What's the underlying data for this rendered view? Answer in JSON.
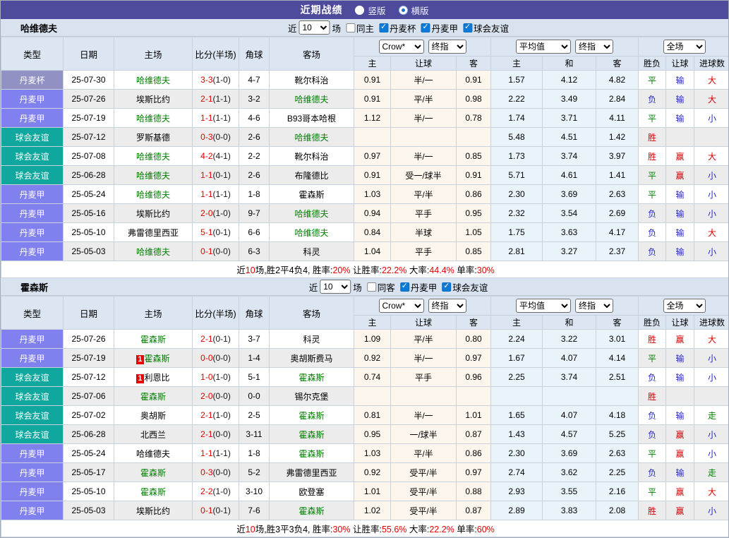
{
  "title_bar": {
    "title": "近期战绩",
    "layout_options": [
      {
        "label": "竖版",
        "selected": false
      },
      {
        "label": "横版",
        "selected": true
      }
    ]
  },
  "table_header": {
    "left_columns": [
      "类型",
      "日期",
      "主场",
      "比分(半场)",
      "角球",
      "客场"
    ],
    "handicap_group_selects": [
      "Crow*",
      "终指"
    ],
    "europe_group_selects": [
      "平均值",
      "终指"
    ],
    "result_group_select": "全场",
    "sub_columns": [
      "主",
      "让球",
      "客",
      "主",
      "和",
      "客",
      "胜负",
      "让球",
      "进球数"
    ]
  },
  "league_colors": {
    "丹麦杯": "#9191c4",
    "丹麦甲": "#8080ee",
    "球会友谊": "#0fa79e"
  },
  "red_card_label": "1",
  "sections": [
    {
      "team": "哈维德夫",
      "filter": {
        "prefix": "近",
        "count": "10",
        "suffix": "场",
        "same_label": "同主",
        "same_checked": false,
        "leagues": [
          {
            "label": "丹麦杯",
            "checked": true
          },
          {
            "label": "丹麦甲",
            "checked": true
          },
          {
            "label": "球会友谊",
            "checked": true
          }
        ]
      },
      "rows": [
        {
          "league": "丹麦杯",
          "date": "25-07-30",
          "home": {
            "name": "哈维德夫",
            "focus": true
          },
          "ft": "3-3",
          "ht": "(1-0)",
          "corners": "4-7",
          "away": {
            "name": "靴尔科治"
          },
          "handicap": [
            "0.91",
            "半/一",
            "0.91"
          ],
          "europe": [
            "1.57",
            "4.12",
            "4.82"
          ],
          "results": [
            {
              "t": "平",
              "c": "green"
            },
            {
              "t": "输",
              "c": "blue"
            },
            {
              "t": "大",
              "c": "red"
            }
          ]
        },
        {
          "league": "丹麦甲",
          "date": "25-07-26",
          "home": {
            "name": "埃斯比约"
          },
          "ft": "2-1",
          "ht": "(1-1)",
          "corners": "3-2",
          "away": {
            "name": "哈维德夫",
            "focus": true
          },
          "handicap": [
            "0.91",
            "平/半",
            "0.98"
          ],
          "europe": [
            "2.22",
            "3.49",
            "2.84"
          ],
          "results": [
            {
              "t": "负",
              "c": "blue"
            },
            {
              "t": "输",
              "c": "blue"
            },
            {
              "t": "大",
              "c": "red"
            }
          ]
        },
        {
          "league": "丹麦甲",
          "date": "25-07-19",
          "home": {
            "name": "哈维德夫",
            "focus": true
          },
          "ft": "1-1",
          "ht": "(1-1)",
          "corners": "4-6",
          "away": {
            "name": "B93哥本哈根"
          },
          "handicap": [
            "1.12",
            "半/一",
            "0.78"
          ],
          "europe": [
            "1.74",
            "3.71",
            "4.11"
          ],
          "results": [
            {
              "t": "平",
              "c": "green"
            },
            {
              "t": "输",
              "c": "blue"
            },
            {
              "t": "小",
              "c": "blue"
            }
          ]
        },
        {
          "league": "球会友谊",
          "date": "25-07-12",
          "home": {
            "name": "罗斯基德"
          },
          "ft": "0-3",
          "ht": "(0-0)",
          "corners": "2-6",
          "away": {
            "name": "哈维德夫",
            "focus": true
          },
          "handicap": [
            "",
            "",
            ""
          ],
          "europe": [
            "5.48",
            "4.51",
            "1.42"
          ],
          "results": [
            {
              "t": "胜",
              "c": "red"
            },
            {
              "t": ""
            },
            {
              "t": ""
            }
          ]
        },
        {
          "league": "球会友谊",
          "date": "25-07-08",
          "home": {
            "name": "哈维德夫",
            "focus": true
          },
          "ft": "4-2",
          "ht": "(4-1)",
          "corners": "2-2",
          "away": {
            "name": "靴尔科治"
          },
          "handicap": [
            "0.97",
            "半/一",
            "0.85"
          ],
          "europe": [
            "1.73",
            "3.74",
            "3.97"
          ],
          "results": [
            {
              "t": "胜",
              "c": "red"
            },
            {
              "t": "赢",
              "c": "red"
            },
            {
              "t": "大",
              "c": "red"
            }
          ]
        },
        {
          "league": "球会友谊",
          "date": "25-06-28",
          "home": {
            "name": "哈维德夫",
            "focus": true
          },
          "ft": "1-1",
          "ht": "(0-1)",
          "corners": "2-6",
          "away": {
            "name": "布隆德比"
          },
          "handicap": [
            "0.91",
            "受一/球半",
            "0.91"
          ],
          "europe": [
            "5.71",
            "4.61",
            "1.41"
          ],
          "results": [
            {
              "t": "平",
              "c": "green"
            },
            {
              "t": "赢",
              "c": "red"
            },
            {
              "t": "小",
              "c": "blue"
            }
          ]
        },
        {
          "league": "丹麦甲",
          "date": "25-05-24",
          "home": {
            "name": "哈维德夫",
            "focus": true
          },
          "ft": "1-1",
          "ht": "(1-1)",
          "corners": "1-8",
          "away": {
            "name": "霍森斯"
          },
          "handicap": [
            "1.03",
            "平/半",
            "0.86"
          ],
          "europe": [
            "2.30",
            "3.69",
            "2.63"
          ],
          "results": [
            {
              "t": "平",
              "c": "green"
            },
            {
              "t": "输",
              "c": "blue"
            },
            {
              "t": "小",
              "c": "blue"
            }
          ]
        },
        {
          "league": "丹麦甲",
          "date": "25-05-16",
          "home": {
            "name": "埃斯比约"
          },
          "ft": "2-0",
          "ht": "(1-0)",
          "corners": "9-7",
          "away": {
            "name": "哈维德夫",
            "focus": true
          },
          "handicap": [
            "0.94",
            "平手",
            "0.95"
          ],
          "europe": [
            "2.32",
            "3.54",
            "2.69"
          ],
          "results": [
            {
              "t": "负",
              "c": "blue"
            },
            {
              "t": "输",
              "c": "blue"
            },
            {
              "t": "小",
              "c": "blue"
            }
          ]
        },
        {
          "league": "丹麦甲",
          "date": "25-05-10",
          "home": {
            "name": "弗雷德里西亚"
          },
          "ft": "5-1",
          "ht": "(0-1)",
          "corners": "6-6",
          "away": {
            "name": "哈维德夫",
            "focus": true
          },
          "handicap": [
            "0.84",
            "半球",
            "1.05"
          ],
          "europe": [
            "1.75",
            "3.63",
            "4.17"
          ],
          "results": [
            {
              "t": "负",
              "c": "blue"
            },
            {
              "t": "输",
              "c": "blue"
            },
            {
              "t": "大",
              "c": "red"
            }
          ]
        },
        {
          "league": "丹麦甲",
          "date": "25-05-03",
          "home": {
            "name": "哈维德夫",
            "focus": true
          },
          "ft": "0-1",
          "ht": "(0-0)",
          "corners": "6-3",
          "away": {
            "name": "科灵"
          },
          "handicap": [
            "1.04",
            "平手",
            "0.85"
          ],
          "europe": [
            "2.81",
            "3.27",
            "2.37"
          ],
          "results": [
            {
              "t": "负",
              "c": "blue"
            },
            {
              "t": "输",
              "c": "blue"
            },
            {
              "t": "小",
              "c": "blue"
            }
          ]
        }
      ],
      "summary": [
        {
          "t": "近"
        },
        {
          "t": "10",
          "red": true
        },
        {
          "t": "场,胜2平4负4, 胜率:"
        },
        {
          "t": "20%",
          "red": true
        },
        {
          "t": " 让胜率:"
        },
        {
          "t": "22.2%",
          "red": true
        },
        {
          "t": " 大率:"
        },
        {
          "t": "44.4%",
          "red": true
        },
        {
          "t": " 单率:"
        },
        {
          "t": "30%",
          "red": true
        }
      ]
    },
    {
      "team": "霍森斯",
      "filter": {
        "prefix": "近",
        "count": "10",
        "suffix": "场",
        "same_label": "同客",
        "same_checked": false,
        "leagues": [
          {
            "label": "丹麦甲",
            "checked": true
          },
          {
            "label": "球会友谊",
            "checked": true
          }
        ]
      },
      "rows": [
        {
          "league": "丹麦甲",
          "date": "25-07-26",
          "home": {
            "name": "霍森斯",
            "focus": true
          },
          "ft": "2-1",
          "ht": "(0-1)",
          "corners": "3-7",
          "away": {
            "name": "科灵"
          },
          "handicap": [
            "1.09",
            "平/半",
            "0.80"
          ],
          "europe": [
            "2.24",
            "3.22",
            "3.01"
          ],
          "results": [
            {
              "t": "胜",
              "c": "red"
            },
            {
              "t": "赢",
              "c": "red"
            },
            {
              "t": "大",
              "c": "red"
            }
          ]
        },
        {
          "league": "丹麦甲",
          "date": "25-07-19",
          "home": {
            "name": "霍森斯",
            "focus": true,
            "red_card": true
          },
          "ft": "0-0",
          "ht": "(0-0)",
          "corners": "1-4",
          "away": {
            "name": "奥胡斯费马"
          },
          "handicap": [
            "0.92",
            "半/一",
            "0.97"
          ],
          "europe": [
            "1.67",
            "4.07",
            "4.14"
          ],
          "results": [
            {
              "t": "平",
              "c": "green"
            },
            {
              "t": "输",
              "c": "blue"
            },
            {
              "t": "小",
              "c": "blue"
            }
          ]
        },
        {
          "league": "球会友谊",
          "date": "25-07-12",
          "home": {
            "name": "利恩比",
            "red_card": true
          },
          "ft": "1-0",
          "ht": "(1-0)",
          "corners": "5-1",
          "away": {
            "name": "霍森斯",
            "focus": true
          },
          "handicap": [
            "0.74",
            "平手",
            "0.96"
          ],
          "europe": [
            "2.25",
            "3.74",
            "2.51"
          ],
          "results": [
            {
              "t": "负",
              "c": "blue"
            },
            {
              "t": "输",
              "c": "blue"
            },
            {
              "t": "小",
              "c": "blue"
            }
          ]
        },
        {
          "league": "球会友谊",
          "date": "25-07-06",
          "home": {
            "name": "霍森斯",
            "focus": true
          },
          "ft": "2-0",
          "ht": "(0-0)",
          "corners": "0-0",
          "away": {
            "name": "锡尔克堡"
          },
          "handicap": [
            "",
            "",
            ""
          ],
          "europe": [
            "",
            "",
            ""
          ],
          "results": [
            {
              "t": "胜",
              "c": "red"
            },
            {
              "t": ""
            },
            {
              "t": ""
            }
          ]
        },
        {
          "league": "球会友谊",
          "date": "25-07-02",
          "home": {
            "name": "奥胡斯"
          },
          "ft": "2-1",
          "ht": "(1-0)",
          "corners": "2-5",
          "away": {
            "name": "霍森斯",
            "focus": true
          },
          "handicap": [
            "0.81",
            "半/一",
            "1.01"
          ],
          "europe": [
            "1.65",
            "4.07",
            "4.18"
          ],
          "results": [
            {
              "t": "负",
              "c": "blue"
            },
            {
              "t": "输",
              "c": "blue"
            },
            {
              "t": "走",
              "c": "green"
            }
          ]
        },
        {
          "league": "球会友谊",
          "date": "25-06-28",
          "home": {
            "name": "北西兰"
          },
          "ft": "2-1",
          "ht": "(0-0)",
          "corners": "3-11",
          "away": {
            "name": "霍森斯",
            "focus": true
          },
          "handicap": [
            "0.95",
            "一/球半",
            "0.87"
          ],
          "europe": [
            "1.43",
            "4.57",
            "5.25"
          ],
          "results": [
            {
              "t": "负",
              "c": "blue"
            },
            {
              "t": "赢",
              "c": "red"
            },
            {
              "t": "小",
              "c": "blue"
            }
          ]
        },
        {
          "league": "丹麦甲",
          "date": "25-05-24",
          "home": {
            "name": "哈维德夫"
          },
          "ft": "1-1",
          "ht": "(1-1)",
          "corners": "1-8",
          "away": {
            "name": "霍森斯",
            "focus": true
          },
          "handicap": [
            "1.03",
            "平/半",
            "0.86"
          ],
          "europe": [
            "2.30",
            "3.69",
            "2.63"
          ],
          "results": [
            {
              "t": "平",
              "c": "green"
            },
            {
              "t": "赢",
              "c": "red"
            },
            {
              "t": "小",
              "c": "blue"
            }
          ]
        },
        {
          "league": "丹麦甲",
          "date": "25-05-17",
          "home": {
            "name": "霍森斯",
            "focus": true
          },
          "ft": "0-3",
          "ht": "(0-0)",
          "corners": "5-2",
          "away": {
            "name": "弗雷德里西亚"
          },
          "handicap": [
            "0.92",
            "受平/半",
            "0.97"
          ],
          "europe": [
            "2.74",
            "3.62",
            "2.25"
          ],
          "results": [
            {
              "t": "负",
              "c": "blue"
            },
            {
              "t": "输",
              "c": "blue"
            },
            {
              "t": "走",
              "c": "green"
            }
          ]
        },
        {
          "league": "丹麦甲",
          "date": "25-05-10",
          "home": {
            "name": "霍森斯",
            "focus": true
          },
          "ft": "2-2",
          "ht": "(1-0)",
          "corners": "3-10",
          "away": {
            "name": "欧登塞"
          },
          "handicap": [
            "1.01",
            "受平/半",
            "0.88"
          ],
          "europe": [
            "2.93",
            "3.55",
            "2.16"
          ],
          "results": [
            {
              "t": "平",
              "c": "green"
            },
            {
              "t": "赢",
              "c": "red"
            },
            {
              "t": "大",
              "c": "red"
            }
          ]
        },
        {
          "league": "丹麦甲",
          "date": "25-05-03",
          "home": {
            "name": "埃斯比约"
          },
          "ft": "0-1",
          "ht": "(0-1)",
          "corners": "7-6",
          "away": {
            "name": "霍森斯",
            "focus": true
          },
          "handicap": [
            "1.02",
            "受平/半",
            "0.87"
          ],
          "europe": [
            "2.89",
            "3.83",
            "2.08"
          ],
          "results": [
            {
              "t": "胜",
              "c": "red"
            },
            {
              "t": "赢",
              "c": "red"
            },
            {
              "t": "小",
              "c": "blue"
            }
          ]
        }
      ],
      "summary": [
        {
          "t": "近"
        },
        {
          "t": "10",
          "red": true
        },
        {
          "t": "场,胜3平3负4, 胜率:"
        },
        {
          "t": "30%",
          "red": true
        },
        {
          "t": " 让胜率:"
        },
        {
          "t": "55.6%",
          "red": true
        },
        {
          "t": " 大率:"
        },
        {
          "t": "22.2%",
          "red": true
        },
        {
          "t": " 单率:"
        },
        {
          "t": "60%",
          "red": true
        }
      ]
    }
  ]
}
